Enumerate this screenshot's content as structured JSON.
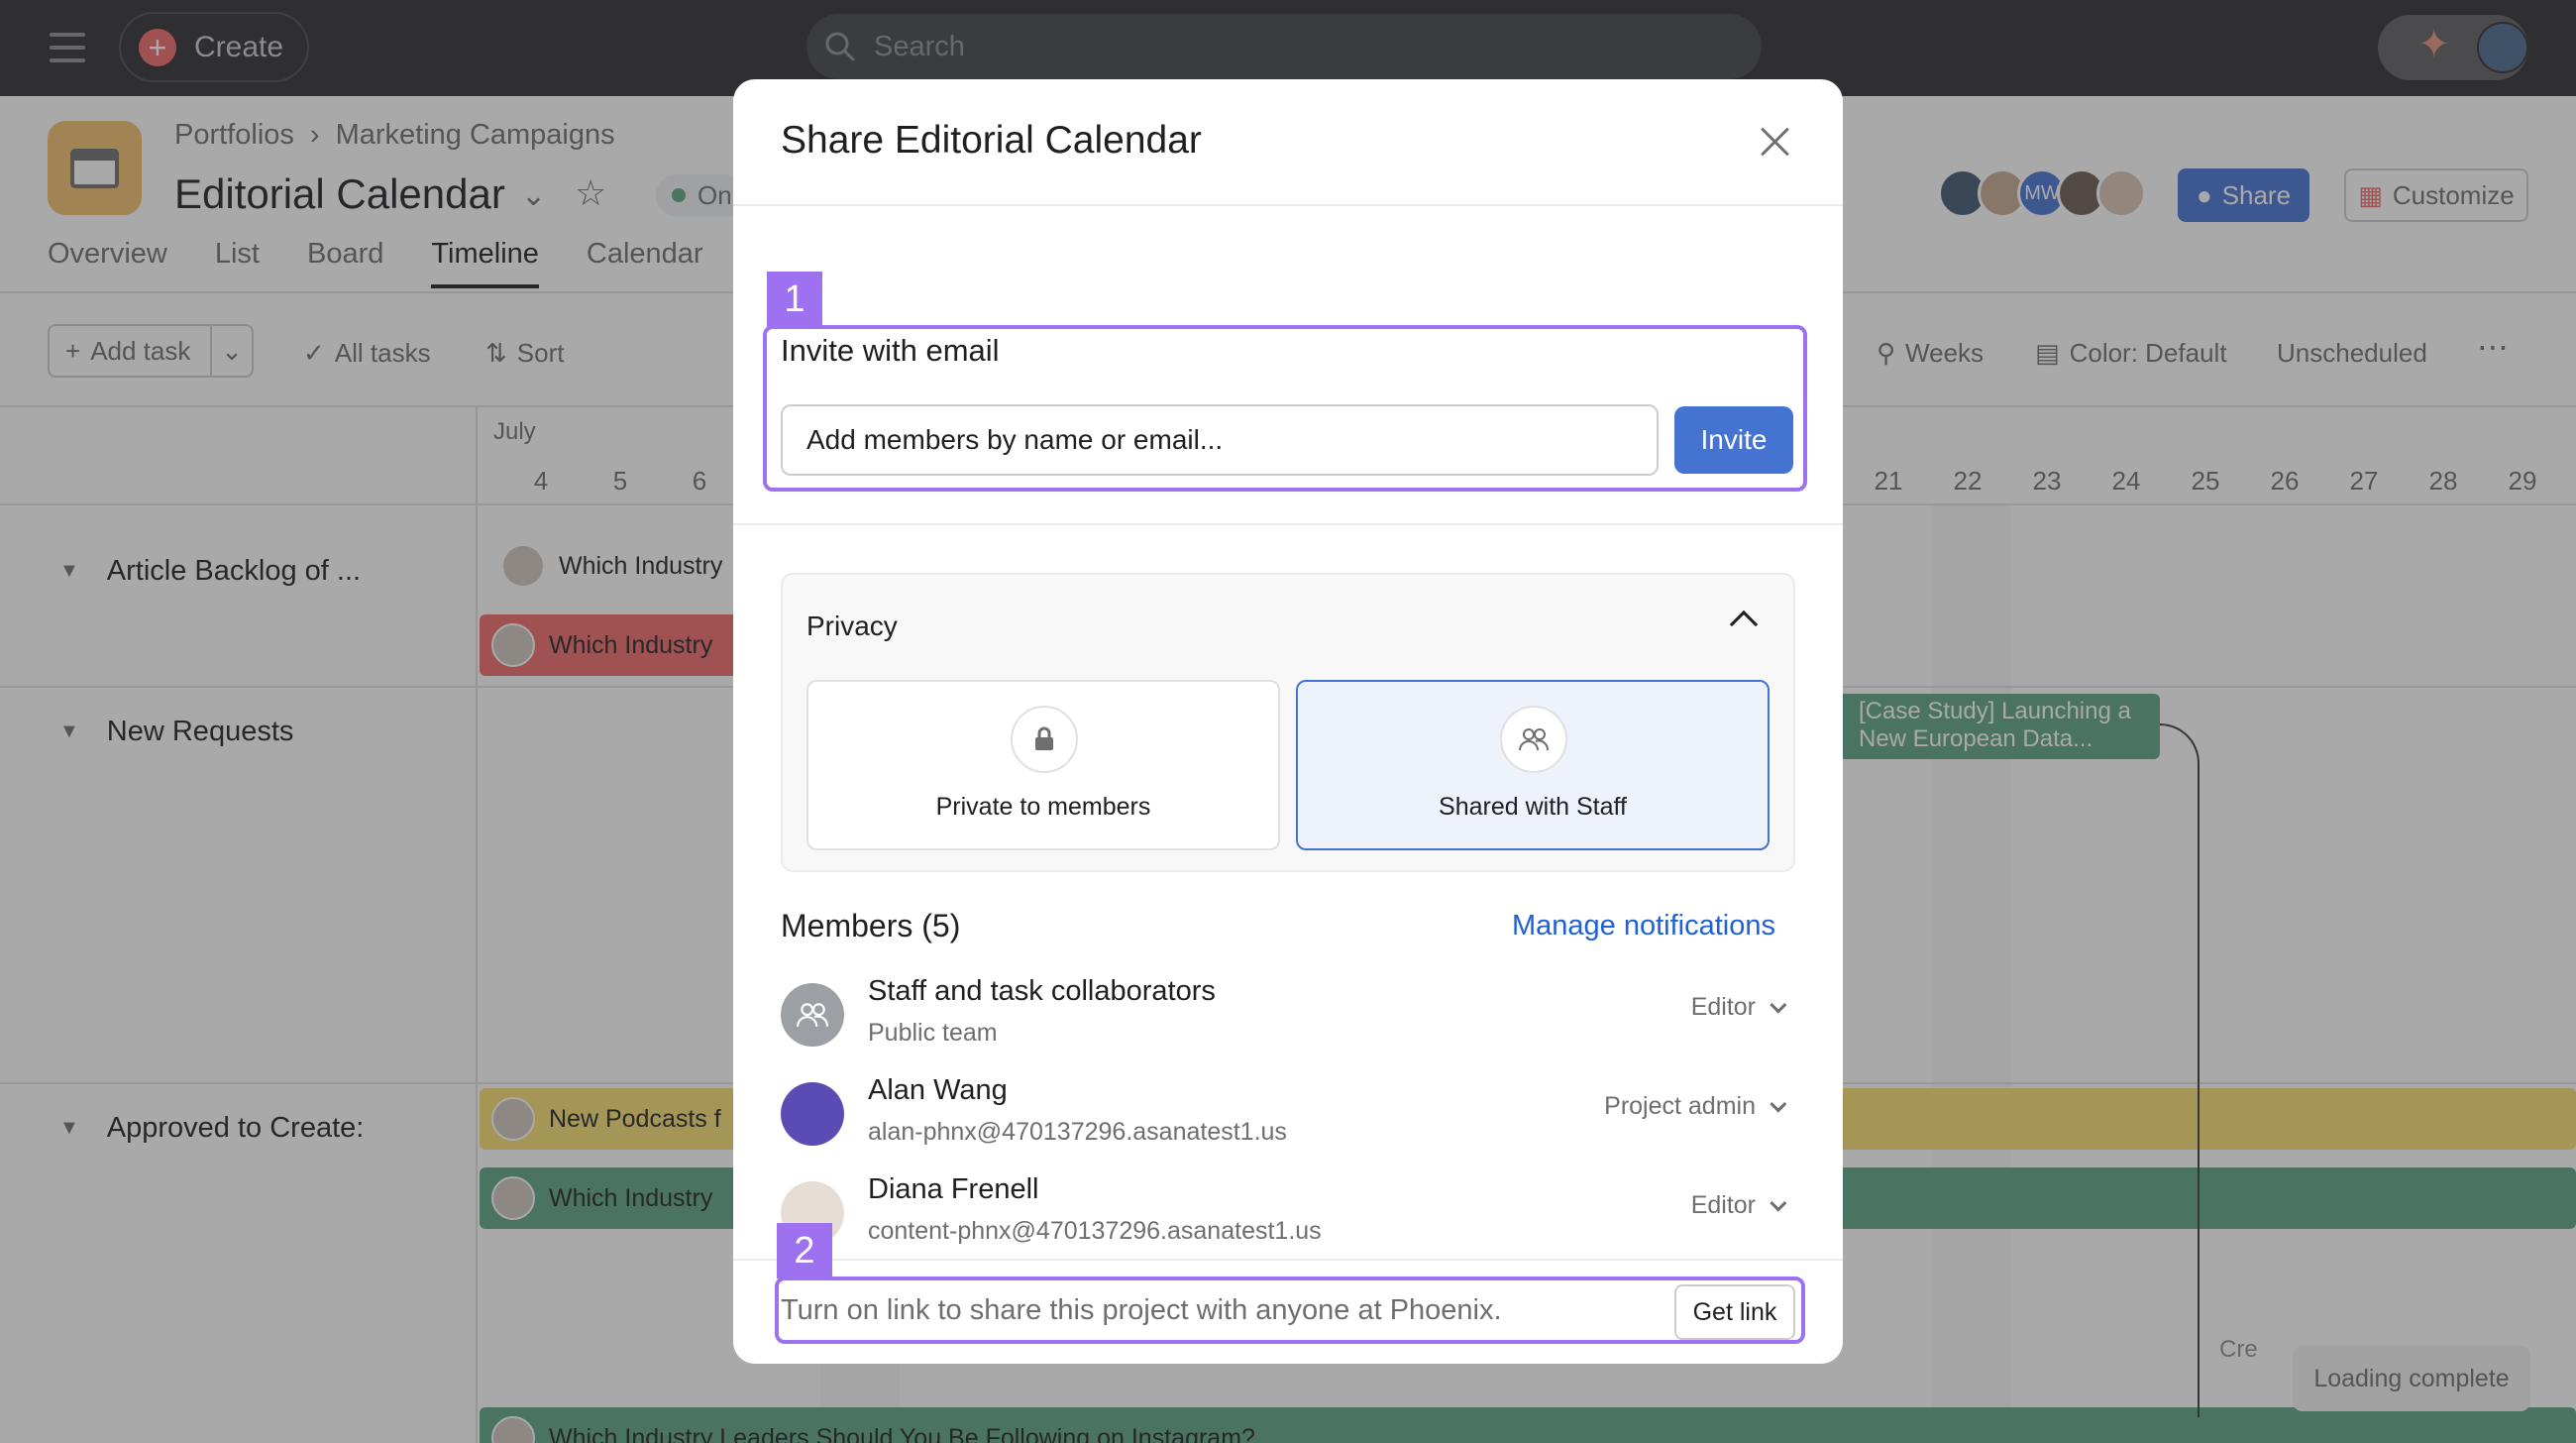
{
  "topbar": {
    "create_label": "Create",
    "search_placeholder": "Search"
  },
  "project": {
    "breadcrumb": [
      "Portfolios",
      "Marketing Campaigns"
    ],
    "title": "Editorial Calendar",
    "status_partial": "On",
    "tabs": [
      "Overview",
      "List",
      "Board",
      "Timeline",
      "Calendar"
    ],
    "active_tab": "Timeline",
    "share_label": "Share",
    "customize_label": "Customize",
    "member_initials": "MW"
  },
  "toolbar": {
    "add_task": "Add task",
    "all_tasks": "All tasks",
    "sort": "Sort",
    "weeks": "Weeks",
    "color": "Color: Default",
    "unscheduled": "Unscheduled"
  },
  "timeline": {
    "month": "July",
    "days_left": [
      "4",
      "5",
      "6"
    ],
    "days_right": [
      "21",
      "22",
      "23",
      "24",
      "25",
      "26",
      "27",
      "28",
      "29"
    ],
    "sections": [
      "Article Backlog of ...",
      "New Requests",
      "Approved to Create:"
    ],
    "bars": [
      "Which Industry",
      "Which Industry",
      "New Podcasts f",
      "Which Industry",
      "Which Industry Leaders Should You Be Following on Instagram?"
    ],
    "case_study": "[Case Study] Launching a New European Data...",
    "cre_text": "Cre",
    "loading": "Loading complete"
  },
  "modal": {
    "title": "Share Editorial Calendar",
    "step1": "1",
    "step2": "2",
    "invite_heading": "Invite with email",
    "invite_placeholder": "Add members by name or email...",
    "invite_button": "Invite",
    "privacy_label": "Privacy",
    "privacy_options": [
      {
        "label": "Private to members",
        "icon": "lock-icon",
        "selected": false
      },
      {
        "label": "Shared with Staff",
        "icon": "team-icon",
        "selected": true
      }
    ],
    "members_heading": "Members (5)",
    "manage_notifications": "Manage notifications",
    "members": [
      {
        "name": "Staff and task collaborators",
        "sub": "Public team",
        "role": "Editor"
      },
      {
        "name": "Alan Wang",
        "sub": "alan-phnx@470137296.asanatest1.us",
        "role": "Project admin"
      },
      {
        "name": "Diana Frenell",
        "sub": "content-phnx@470137296.asanatest1.us",
        "role": "Editor"
      }
    ],
    "link_text": "Turn on link to share this project with anyone at Phoenix.",
    "get_link": "Get link"
  },
  "colors": {
    "accent_blue": "#4573d2",
    "annotation_purple": "#9d71f0",
    "link_blue": "#1e61d6"
  }
}
